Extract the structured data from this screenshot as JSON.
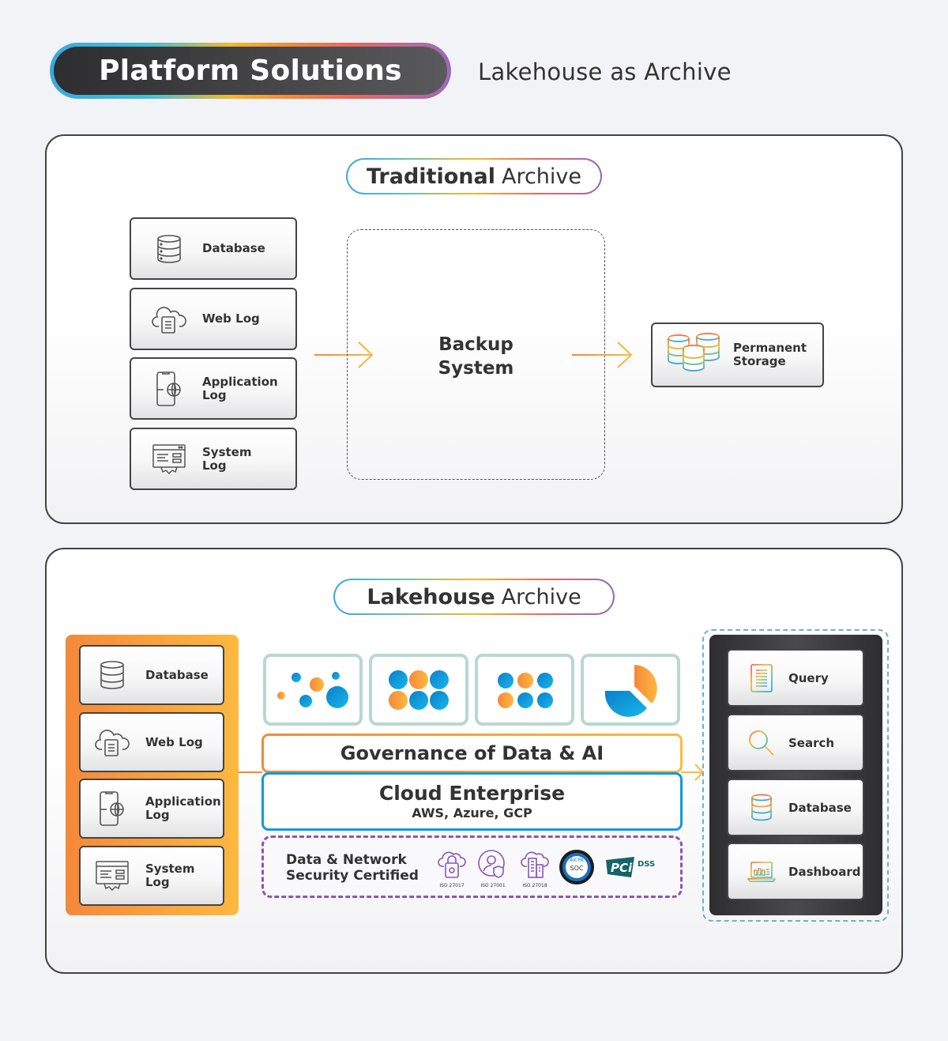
{
  "header": {
    "title": "Platform Solutions",
    "subtitle": "Lakehouse as Archive"
  },
  "traditional": {
    "title_bold": "Traditional",
    "title_light": "Archive",
    "sources": [
      {
        "label": "Database",
        "icon": "database-icon"
      },
      {
        "label": "Web Log",
        "icon": "cloud-document-icon"
      },
      {
        "label": "Application\nLog",
        "icon": "mobile-globe-icon"
      },
      {
        "label": "System\nLog",
        "icon": "system-gear-icon"
      }
    ],
    "backup_label": "Backup\nSystem",
    "storage_label": "Permanent\nStorage"
  },
  "lakehouse": {
    "title_bold": "Lakehouse",
    "title_light": "Archive",
    "sources": [
      {
        "label": "Database",
        "icon": "database-icon"
      },
      {
        "label": "Web Log",
        "icon": "cloud-document-icon"
      },
      {
        "label": "Application\nLog",
        "icon": "mobile-globe-icon"
      },
      {
        "label": "System\nLog",
        "icon": "system-gear-icon"
      }
    ],
    "tiles": [
      {
        "icon": "scatter-bubbles-icon"
      },
      {
        "icon": "dot-grid-large-icon"
      },
      {
        "icon": "dot-grid-small-icon"
      },
      {
        "icon": "pie-chart-icon"
      }
    ],
    "governance_label": "Governance of Data & AI",
    "cloud_title": "Cloud Enterprise",
    "cloud_providers": "AWS, Azure, GCP",
    "security_label": "Data & Network\nSecurity Certified",
    "certifications": [
      {
        "caption": "ISO 27017",
        "icon": "cloud-lock-icon"
      },
      {
        "caption": "ISO 27001",
        "icon": "user-shield-icon"
      },
      {
        "caption": "ISO 27018",
        "icon": "cloud-building-icon"
      },
      {
        "caption": "AICPA SOC",
        "icon": "aicpa-soc-badge"
      },
      {
        "caption": "PCI DSS",
        "icon": "pci-dss-logo"
      }
    ],
    "outputs": [
      {
        "label": "Query",
        "icon": "document-lines-icon"
      },
      {
        "label": "Search",
        "icon": "magnifier-icon"
      },
      {
        "label": "Database",
        "icon": "database-icon"
      },
      {
        "label": "Dashboard",
        "icon": "laptop-chart-icon"
      }
    ]
  },
  "colors": {
    "orange": "#f5883a",
    "amber": "#fdb940",
    "blue": "#0f9bd6",
    "purple": "#8a55b8",
    "teal_tile_border": "#b8d8d0",
    "dark": "#333333"
  }
}
